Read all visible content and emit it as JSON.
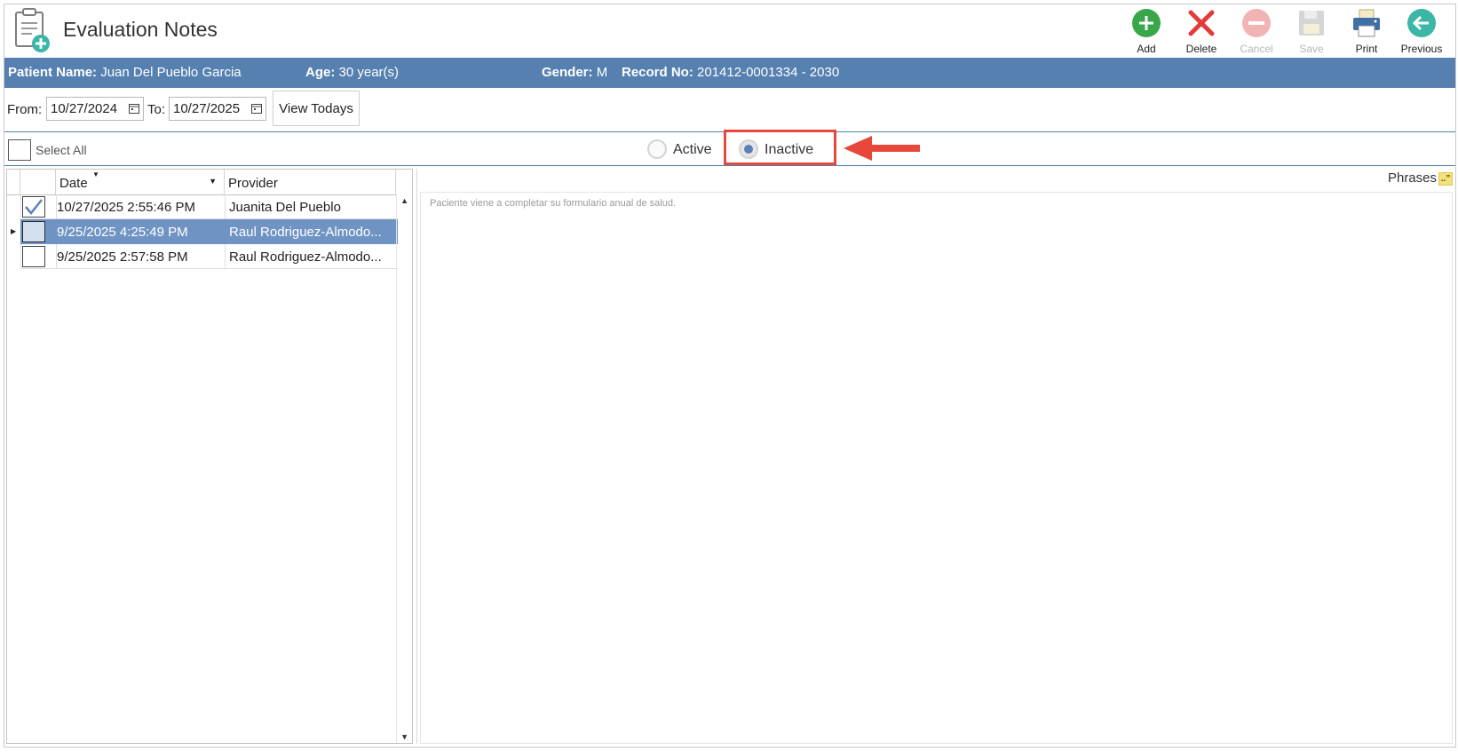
{
  "header": {
    "title": "Evaluation Notes",
    "toolbar": [
      {
        "key": "add",
        "label": "Add",
        "icon": "add-icon",
        "enabled": true
      },
      {
        "key": "delete",
        "label": "Delete",
        "icon": "delete-icon",
        "enabled": true
      },
      {
        "key": "cancel",
        "label": "Cancel",
        "icon": "cancel-icon",
        "enabled": false
      },
      {
        "key": "save",
        "label": "Save",
        "icon": "save-icon",
        "enabled": false
      },
      {
        "key": "print",
        "label": "Print",
        "icon": "print-icon",
        "enabled": true
      },
      {
        "key": "previous",
        "label": "Previous",
        "icon": "previous-icon",
        "enabled": true
      }
    ]
  },
  "patient": {
    "name_label": "Patient Name:",
    "name": "Juan Del Pueblo Garcia",
    "age_label": "Age:",
    "age": "30 year(s)",
    "gender_label": "Gender:",
    "gender": "M",
    "record_label": "Record No:",
    "record": "201412-0001334 - 2030"
  },
  "filter": {
    "from_label": "From:",
    "from_value": "10/27/2024",
    "to_label": "To:",
    "to_value": "10/27/2025",
    "view_button": "View Todays"
  },
  "status": {
    "select_all": "Select All",
    "active_label": "Active",
    "inactive_label": "Inactive",
    "selected": "Inactive"
  },
  "grid": {
    "columns": [
      "Date",
      "Provider"
    ],
    "rows": [
      {
        "date": "10/27/2025 2:55:46 PM",
        "provider": "Juanita Del Pueblo",
        "checked": true,
        "selected": false
      },
      {
        "date": "9/25/2025 4:25:49 PM",
        "provider": "Raul Rodriguez-Almodo...",
        "checked": false,
        "selected": true
      },
      {
        "date": "9/25/2025 2:57:58 PM",
        "provider": "Raul Rodriguez-Almodo...",
        "checked": false,
        "selected": false
      }
    ]
  },
  "notes": {
    "phrases_label": "Phrases",
    "text": "Paciente viene a completar su formulario anual de salud."
  },
  "colors": {
    "header_bar": "#5580b0",
    "selected_row": "#6f94c4",
    "highlight": "#e8473b",
    "add": "#3aa64a",
    "delete": "#e23b3b",
    "previous": "#3cb6a6"
  }
}
